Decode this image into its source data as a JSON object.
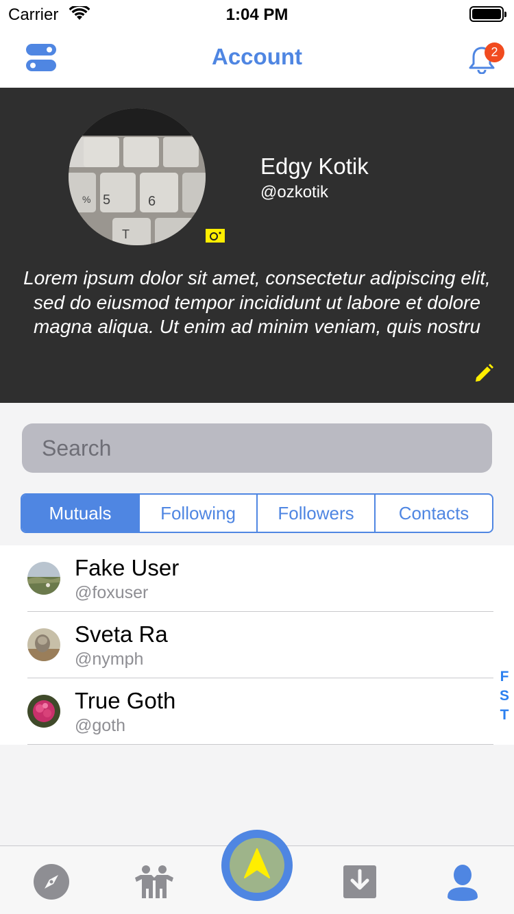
{
  "status_bar": {
    "carrier": "Carrier",
    "time": "1:04 PM"
  },
  "nav": {
    "title": "Account",
    "notification_count": "2"
  },
  "profile": {
    "name": "Edgy Kotik",
    "handle": "@ozkotik",
    "bio": "Lorem ipsum dolor sit amet, consectetur adipiscing elit, sed do eiusmod tempor incididunt ut labore et dolore magna aliqua. Ut enim ad minim veniam, quis nostru"
  },
  "search": {
    "placeholder": "Search",
    "value": ""
  },
  "segments": [
    "Mutuals",
    "Following",
    "Followers",
    "Contacts"
  ],
  "selected_segment": "Mutuals",
  "users": [
    {
      "name": "Fake User",
      "handle": "@foxuser"
    },
    {
      "name": "Sveta Ra",
      "handle": "@nymph"
    },
    {
      "name": "True Goth",
      "handle": "@goth"
    }
  ],
  "index_letters": [
    "F",
    "S",
    "T"
  ],
  "tabs": [
    "compass-icon",
    "people-icon",
    "navigation-arrow-icon",
    "download-icon",
    "profile-icon"
  ],
  "colors": {
    "accent": "#4f86e2",
    "header_bg": "#2f2f2f",
    "badge": "#f14b1f",
    "highlight_yellow": "#ffee00",
    "index_blue": "#2c80f0"
  }
}
